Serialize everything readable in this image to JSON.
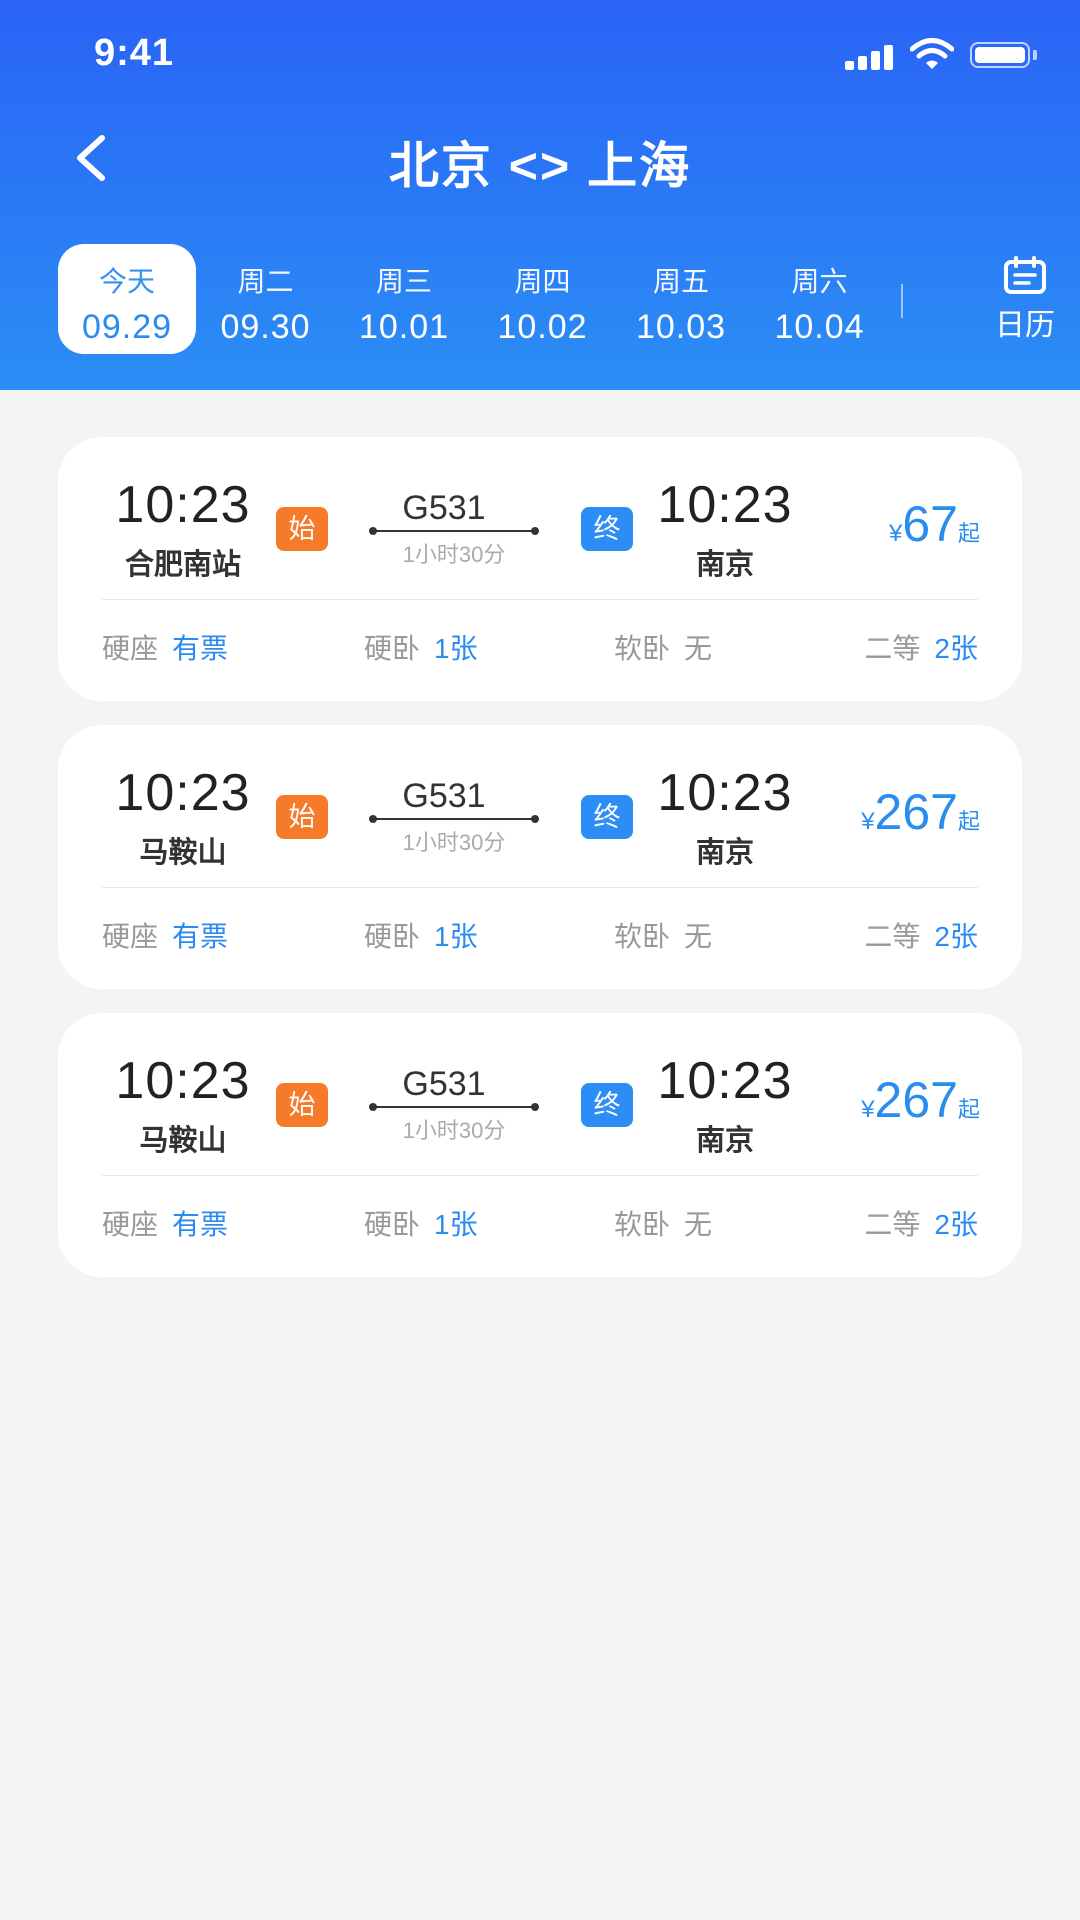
{
  "status_bar": {
    "time": "9:41"
  },
  "header": {
    "title": "北京 <> 上海"
  },
  "dates": [
    {
      "dow": "今天",
      "date": "09.29",
      "active": true
    },
    {
      "dow": "周二",
      "date": "09.30",
      "active": false
    },
    {
      "dow": "周三",
      "date": "10.01",
      "active": false
    },
    {
      "dow": "周四",
      "date": "10.02",
      "active": false
    },
    {
      "dow": "周五",
      "date": "10.03",
      "active": false
    },
    {
      "dow": "周六",
      "date": "10.04",
      "active": false
    }
  ],
  "calendar_label": "日历",
  "colors": {
    "accent": "#2a8cf0",
    "start_badge": "#f57b2a",
    "end_badge": "#2b8df5",
    "header_top": "#2a63f6",
    "header_bottom": "#2b8ef5"
  },
  "trains": [
    {
      "dep_time": "10:23",
      "dep_station": "合肥南站",
      "start_badge": "始",
      "train_no": "G531",
      "duration": "1小时30分",
      "end_badge": "终",
      "arr_time": "10:23",
      "arr_station": "南京",
      "price_symbol": "¥",
      "price": "67",
      "price_suffix": "起",
      "seats": [
        {
          "name": "硬座",
          "avail": "有票"
        },
        {
          "name": "硬卧",
          "avail": "1张"
        },
        {
          "name": "软卧",
          "avail": "无"
        },
        {
          "name": "二等",
          "avail": "2张"
        }
      ]
    },
    {
      "dep_time": "10:23",
      "dep_station": "马鞍山",
      "start_badge": "始",
      "train_no": "G531",
      "duration": "1小时30分",
      "end_badge": "终",
      "arr_time": "10:23",
      "arr_station": "南京",
      "price_symbol": "¥",
      "price": "267",
      "price_suffix": "起",
      "seats": [
        {
          "name": "硬座",
          "avail": "有票"
        },
        {
          "name": "硬卧",
          "avail": "1张"
        },
        {
          "name": "软卧",
          "avail": "无"
        },
        {
          "name": "二等",
          "avail": "2张"
        }
      ]
    },
    {
      "dep_time": "10:23",
      "dep_station": "马鞍山",
      "start_badge": "始",
      "train_no": "G531",
      "duration": "1小时30分",
      "end_badge": "终",
      "arr_time": "10:23",
      "arr_station": "南京",
      "price_symbol": "¥",
      "price": "267",
      "price_suffix": "起",
      "seats": [
        {
          "name": "硬座",
          "avail": "有票"
        },
        {
          "name": "硬卧",
          "avail": "1张"
        },
        {
          "name": "软卧",
          "avail": "无"
        },
        {
          "name": "二等",
          "avail": "2张"
        }
      ]
    }
  ]
}
